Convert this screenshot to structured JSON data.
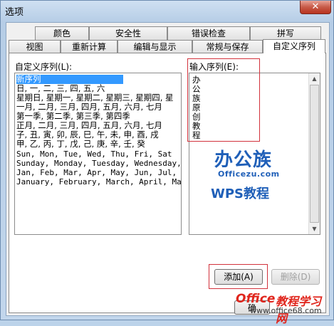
{
  "window": {
    "title": "选项",
    "close_label": "✕"
  },
  "tabs_row1": [
    "颜色",
    "安全性",
    "错误检查",
    "拼写"
  ],
  "tabs_row2": [
    "视图",
    "重新计算",
    "编辑与显示",
    "常规与保存",
    "自定义序列"
  ],
  "custom_lists": {
    "label": "自定义序列(L):",
    "items": [
      "新序列",
      "日, 一, 二, 三, 四, 五, 六",
      "星期日, 星期一, 星期二, 星期三, 星期四, 星",
      "一月, 二月, 三月, 四月, 五月, 六月, 七月",
      "第一季, 第二季, 第三季, 第四季",
      "正月, 二月, 三月, 四月, 五月, 六月, 七月",
      "子, 丑, 寅, 卯, 辰, 巳, 午, 未, 申, 酉, 戌",
      "甲, 乙, 丙, 丁, 戊, 己, 庚, 辛, 壬, 癸",
      "Sun, Mon, Tue, Wed, Thu, Fri, Sat",
      "Sunday, Monday, Tuesday, Wednesday, Thursday",
      "Jan, Feb, Mar, Apr, May, Jun, Jul, Aug",
      "January, February, March, April, May, June"
    ],
    "selected_index": 0
  },
  "entries": {
    "label": "输入序列(E):",
    "values": [
      "办",
      "公",
      "族",
      "原",
      "创",
      "教",
      "程"
    ]
  },
  "buttons": {
    "add": "添加(A)",
    "delete": "删除(D)",
    "ok_partial": "确"
  },
  "watermarks": {
    "brand": "办公族",
    "site": "Officezu.com",
    "wps_a": "WPS",
    "wps_b": "教程",
    "footer_a": "Office",
    "footer_b": "教程学习网",
    "footer_url": "www.office68.com"
  },
  "colors": {
    "selection": "#3399ff",
    "highlight_box": "#d2323c",
    "brand_blue": "#1f5fb8"
  }
}
